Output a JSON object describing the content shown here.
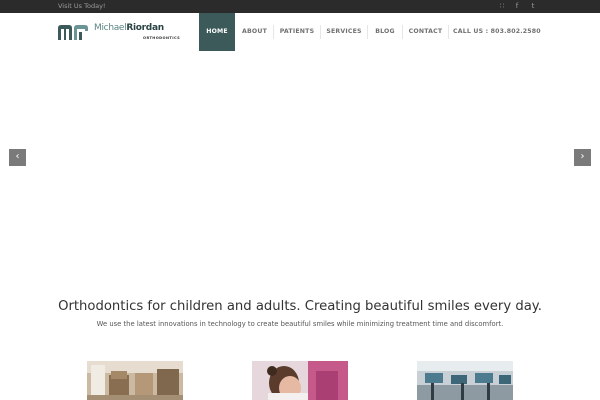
{
  "topbar": {
    "visit_text": "Visit Us Today!",
    "social": [
      {
        "icon": "rss-icon",
        "glyph": "∷"
      },
      {
        "icon": "facebook-icon",
        "glyph": "f"
      },
      {
        "icon": "tumblr-icon",
        "glyph": "t"
      }
    ]
  },
  "logo": {
    "first": "Michael",
    "last": "Riordan",
    "sub": "ORTHODONTICS"
  },
  "nav": {
    "home": "HOME",
    "about": "ABOUT",
    "patients": "PATIENTS",
    "services": "SERVICES",
    "blog": "BLOG",
    "contact": "CONTACT",
    "call": "CALL US : 803.802.2580"
  },
  "slider": {
    "prev_glyph": "‹",
    "next_glyph": "›"
  },
  "intro": {
    "tagline": "Orthodontics for children and adults. Creating beautiful smiles every day.",
    "subline": "We use the latest innovations in technology to create beautiful smiles while minimizing treatment time and discomfort."
  },
  "colors": {
    "accent": "#3d5a5b",
    "topbar": "#2b2b2b"
  }
}
